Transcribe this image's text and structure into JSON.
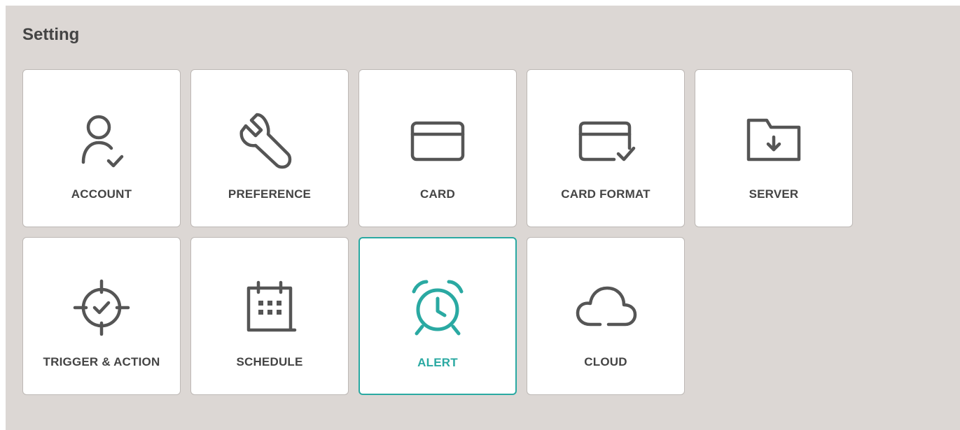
{
  "header": {
    "title": "Setting"
  },
  "tiles": [
    {
      "label": "ACCOUNT",
      "icon": "account-icon",
      "active": false
    },
    {
      "label": "PREFERENCE",
      "icon": "wrench-icon",
      "active": false
    },
    {
      "label": "CARD",
      "icon": "card-icon",
      "active": false
    },
    {
      "label": "CARD FORMAT",
      "icon": "card-format-icon",
      "active": false
    },
    {
      "label": "SERVER",
      "icon": "folder-download-icon",
      "active": false
    },
    {
      "label": "TRIGGER & ACTION",
      "icon": "target-check-icon",
      "active": false
    },
    {
      "label": "SCHEDULE",
      "icon": "calendar-icon",
      "active": false
    },
    {
      "label": "ALERT",
      "icon": "alarm-clock-icon",
      "active": true
    },
    {
      "label": "CLOUD",
      "icon": "cloud-icon",
      "active": false
    }
  ],
  "colors": {
    "background": "#dcd7d4",
    "accent": "#2aa9a2",
    "icon": "#555555",
    "text": "#444444"
  }
}
